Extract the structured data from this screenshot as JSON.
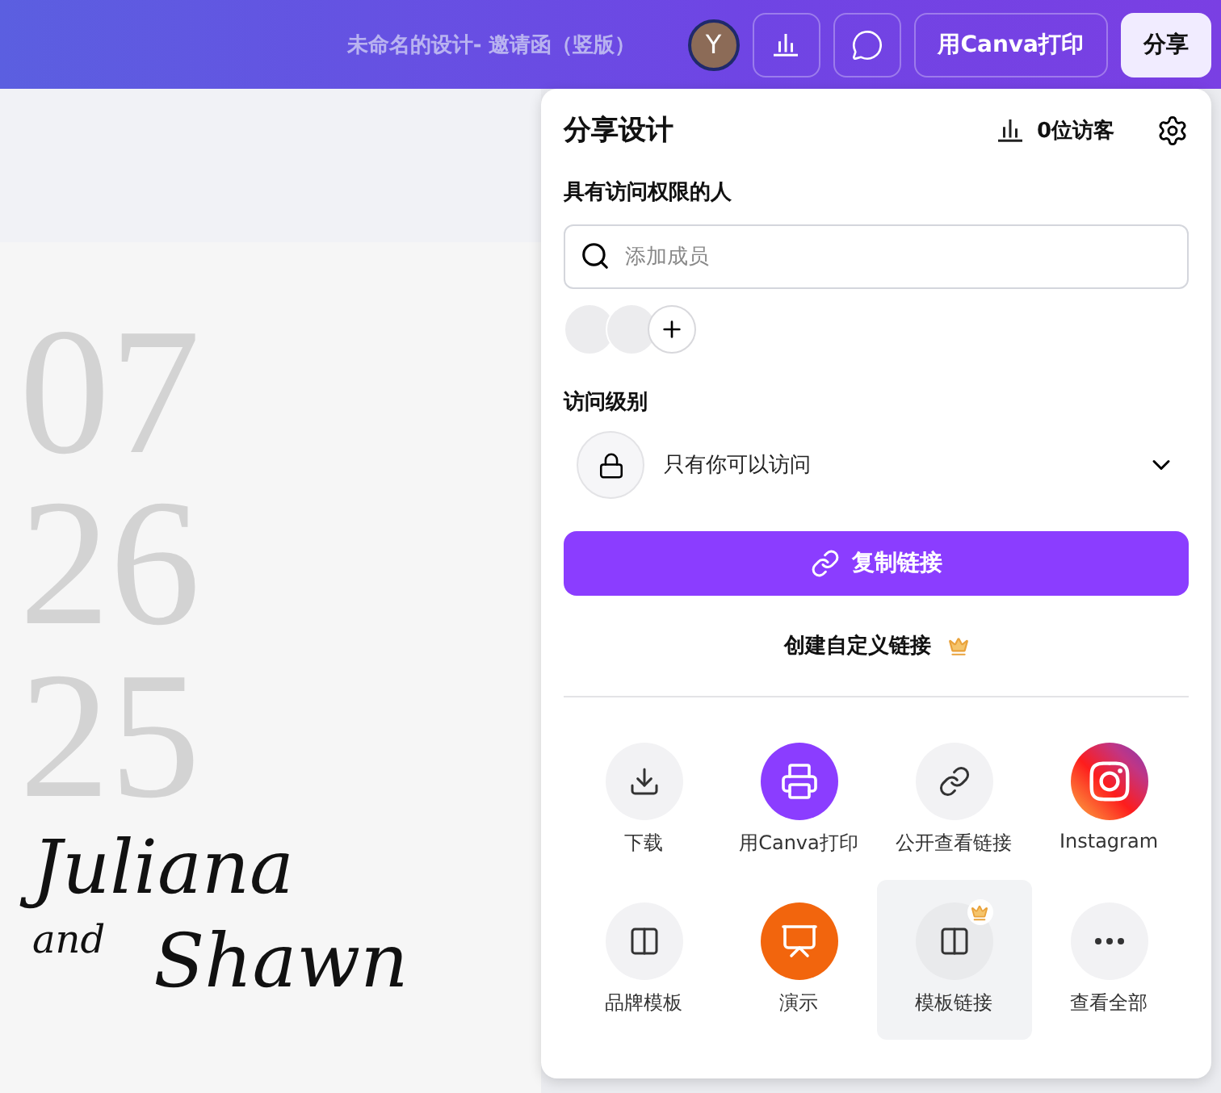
{
  "topbar": {
    "title": "未命名的设计- 邀请函（竖版）",
    "avatar": "Y",
    "print_button": "用Canva打印",
    "share_button": "分享"
  },
  "design": {
    "date_lines": [
      "07",
      "26",
      "25"
    ],
    "first_name": "Juliana",
    "conjunction": "and",
    "second_name": "Shawn"
  },
  "share_panel": {
    "title": "分享设计",
    "visitors": "0位访客",
    "people_label": "具有访问权限的人",
    "search": {
      "placeholder": "添加成员"
    },
    "access_label": "访问级别",
    "access": {
      "value": "只有你可以访问"
    },
    "copy_button": "复制链接",
    "custom_link": {
      "label": "创建自定义链接",
      "premium": true
    },
    "options": [
      {
        "kind": "download",
        "label": "下载",
        "premium": false,
        "selected": false
      },
      {
        "kind": "print",
        "label": "用Canva打印",
        "premium": false,
        "selected": false
      },
      {
        "kind": "public-link",
        "label": "公开查看链接",
        "premium": false,
        "selected": false
      },
      {
        "kind": "instagram",
        "label": "Instagram",
        "premium": false,
        "selected": false
      },
      {
        "kind": "brand-template",
        "label": "品牌模板",
        "premium": false,
        "selected": false
      },
      {
        "kind": "present",
        "label": "演示",
        "premium": false,
        "selected": false
      },
      {
        "kind": "template-link",
        "label": "模板链接",
        "premium": true,
        "selected": true
      },
      {
        "kind": "more",
        "label": "查看全部",
        "premium": false,
        "selected": false
      }
    ]
  }
}
